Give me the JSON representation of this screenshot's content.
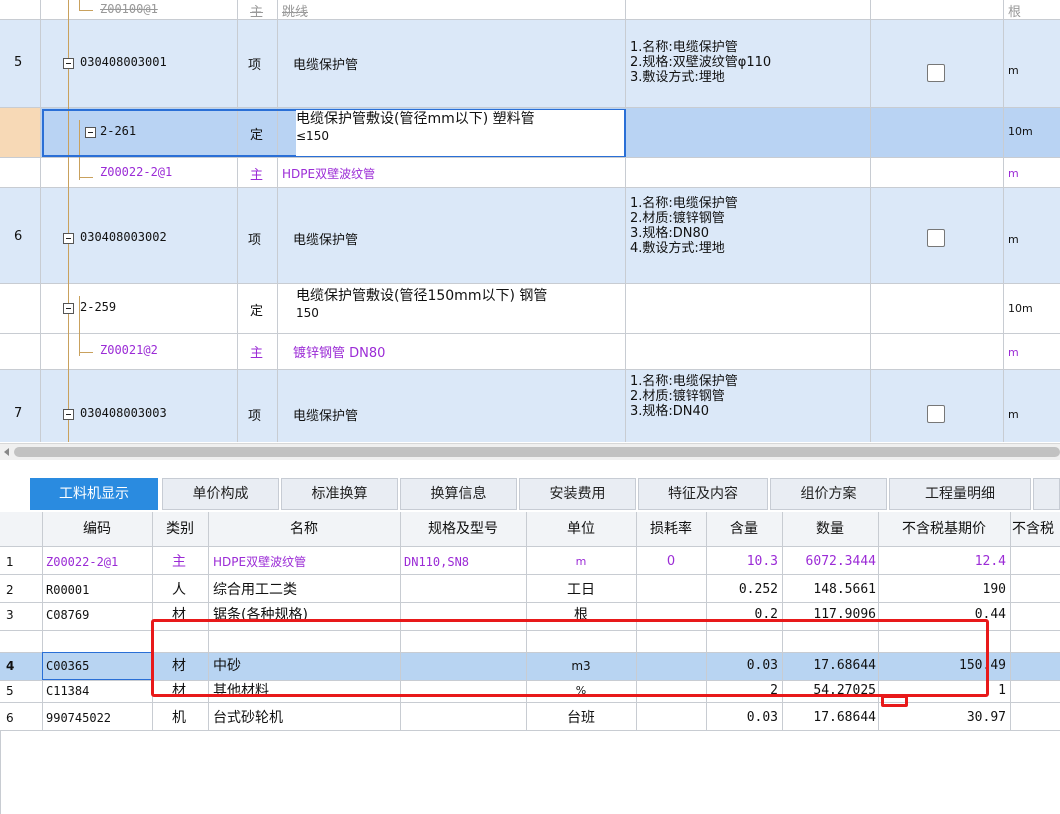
{
  "upper": {
    "rows": [
      {
        "num": "",
        "code": "Z00100@1",
        "type": "主",
        "name": "跳线",
        "unit": "根"
      },
      {
        "num": "5",
        "code": "030408003001",
        "type": "项",
        "name": "电缆保护管",
        "features": [
          "1.名称:电缆保护管",
          "2.规格:双壁波纹管φ110",
          "3.敷设方式:埋地"
        ],
        "unit": "m"
      },
      {
        "num": "",
        "code": "2-261",
        "type": "定",
        "name_lines": [
          "电缆保护管敷设(管径mm以下) 塑料管",
          "≤150"
        ],
        "unit": "10m"
      },
      {
        "num": "",
        "code": "Z00022-2@1",
        "type": "主",
        "name": "HDPE双壁波纹管",
        "unit": "m"
      },
      {
        "num": "6",
        "code": "030408003002",
        "type": "项",
        "name": "电缆保护管",
        "features": [
          "1.名称:电缆保护管",
          "2.材质:镀锌钢管",
          "3.规格:DN80",
          "4.敷设方式:埋地"
        ],
        "unit": "m"
      },
      {
        "num": "",
        "code": "2-259",
        "type": "定",
        "name_lines": [
          "电缆保护管敷设(管径150mm以下) 钢管",
          "150"
        ],
        "unit": "10m"
      },
      {
        "num": "",
        "code": "Z00021@2",
        "type": "主",
        "name": "镀锌钢管 DN80",
        "unit": "m"
      },
      {
        "num": "7",
        "code": "030408003003",
        "type": "项",
        "name": "电缆保护管",
        "features": [
          "1.名称:电缆保护管",
          "2.材质:镀锌钢管",
          "3.规格:DN40"
        ],
        "unit": "m"
      }
    ]
  },
  "tabs": [
    "工料机显示",
    "单价构成",
    "标准换算",
    "换算信息",
    "安装费用",
    "特征及内容",
    "组价方案",
    "工程量明细",
    ""
  ],
  "lower": {
    "headers": [
      "编码",
      "类别",
      "名称",
      "规格及型号",
      "单位",
      "损耗率",
      "含量",
      "数量",
      "不含税基期价",
      "不含税"
    ],
    "rows": [
      {
        "num": "1",
        "code": "Z00022-2@1",
        "type": "主",
        "name": "HDPE双壁波纹管",
        "spec": "DN110,SN8",
        "unit": "m",
        "loss": "0",
        "content": "10.3",
        "qty": "6072.3444",
        "price": "12.4"
      },
      {
        "num": "2",
        "code": "R00001",
        "type": "人",
        "name": "综合用工二类",
        "spec": "",
        "unit": "工日",
        "loss": "",
        "content": "0.252",
        "qty": "148.5661",
        "price": "190"
      },
      {
        "num": "3",
        "code": "C08769",
        "type": "材",
        "name": "锯条(各种规格)",
        "spec": "",
        "unit": "根",
        "loss": "",
        "content": "0.2",
        "qty": "117.9096",
        "price": "0.44"
      },
      {
        "num": "4",
        "code": "C00365",
        "type": "材",
        "name": "中砂",
        "spec": "",
        "unit": "m3",
        "loss": "",
        "content": "0.03",
        "qty": "17.68644",
        "price": "150.49"
      },
      {
        "num": "5",
        "code": "C11384",
        "type": "材",
        "name": "其他材料",
        "spec": "",
        "unit": "%",
        "loss": "",
        "content": "2",
        "qty": "54.27025",
        "price": "1"
      },
      {
        "num": "6",
        "code": "990745022",
        "type": "机",
        "name": "台式砂轮机",
        "spec": "",
        "unit": "台班",
        "loss": "",
        "content": "0.03",
        "qty": "17.68644",
        "price": "30.97"
      }
    ]
  },
  "colors": {
    "accent": "#2a8be0",
    "row_highlight": "#dbe8f8",
    "selected_row": "#b8d4f2",
    "purple": "#9b2bd6",
    "annotation": "#e8191a"
  }
}
